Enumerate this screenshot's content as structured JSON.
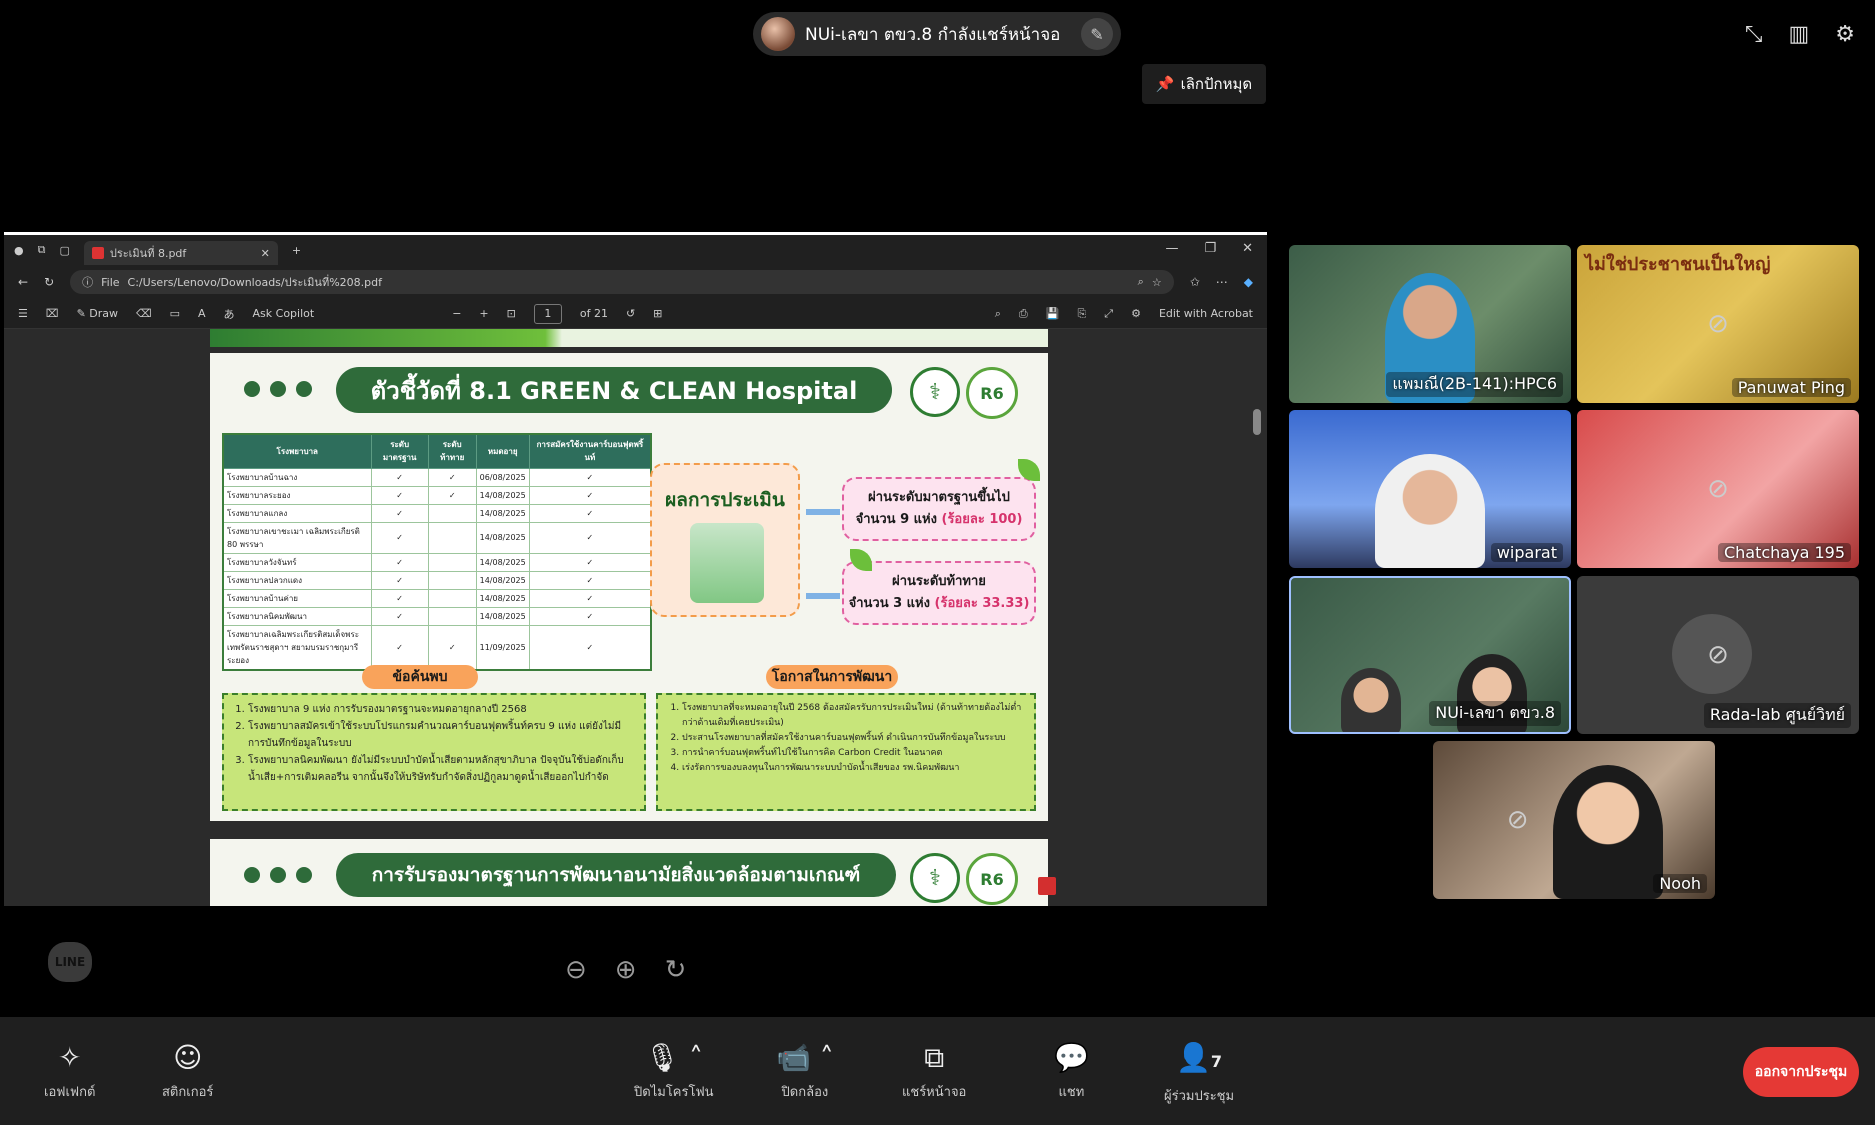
{
  "presenter": {
    "label": "NUi-เลขา ตขว.8 กำลังแชร์หน้าจอ"
  },
  "unpin": {
    "label": "เลิกปักหมุด"
  },
  "browser": {
    "tab_title": "ประเมินที่ 8.pdf",
    "address_prefix": "File",
    "address": "C:/Users/Lenovo/Downloads/ประเมินที่%208.pdf",
    "pdf_draw": "Draw",
    "ask_copilot": "Ask Copilot",
    "page_num": "1",
    "page_total": "of 21",
    "edit_acrobat": "Edit with Acrobat"
  },
  "slide": {
    "title": "ตัวชี้วัดที่ 8.1 GREEN & CLEAN Hospital",
    "logo2_text": "R6",
    "table_headers": [
      "โรงพยาบาล",
      "ระดับมาตรฐาน",
      "ระดับท้าทาย",
      "หมดอายุ",
      "การสมัครใช้งานคาร์บอนฟุตพริ้นท์"
    ],
    "rows": [
      [
        "โรงพยาบาลบ้านฉาง",
        "✓",
        "✓",
        "06/08/2025",
        "✓"
      ],
      [
        "โรงพยาบาลระยอง",
        "✓",
        "✓",
        "14/08/2025",
        "✓"
      ],
      [
        "โรงพยาบาลแกลง",
        "✓",
        "",
        "14/08/2025",
        "✓"
      ],
      [
        "โรงพยาบาลเขาชะเมา เฉลิมพระเกียรติ 80 พรรษา",
        "✓",
        "",
        "14/08/2025",
        "✓"
      ],
      [
        "โรงพยาบาลวังจันทร์",
        "✓",
        "",
        "14/08/2025",
        "✓"
      ],
      [
        "โรงพยาบาลปลวกแดง",
        "✓",
        "",
        "14/08/2025",
        "✓"
      ],
      [
        "โรงพยาบาลบ้านค่าย",
        "✓",
        "",
        "14/08/2025",
        "✓"
      ],
      [
        "โรงพยาบาลนิคมพัฒนา",
        "✓",
        "",
        "14/08/2025",
        "✓"
      ],
      [
        "โรงพยาบาลเฉลิมพระเกียรติสมเด็จพระเทพรัตนราชสุดาฯ สยามบรมราชกุมารี ระยอง",
        "✓",
        "✓",
        "11/09/2025",
        "✓"
      ]
    ],
    "eval_label": "ผลการประเมิน",
    "result1_line1": "ผ่านระดับมาตรฐานขึ้นไป",
    "result1_line2": "จำนวน 9 แห่ง",
    "result1_pct": "(ร้อยละ 100)",
    "result2_line1": "ผ่านระดับท้าทาย",
    "result2_line2": "จำนวน 3 แห่ง",
    "result2_pct": "(ร้อยละ 33.33)",
    "findings_title": "ข้อค้นพบ",
    "findings": [
      "โรงพยาบาล 9 แห่ง การรับรองมาตรฐานจะหมดอายุกลางปี 2568",
      "โรงพยาบาลสมัครเข้าใช้ระบบโปรแกรมคำนวณคาร์บอนฟุตพริ้นท์ครบ 9 แห่ง แต่ยังไม่มีการบันทึกข้อมูลในระบบ",
      "โรงพยาบาลนิคมพัฒนา ยังไม่มีระบบบำบัดน้ำเสียตามหลักสุขาภิบาล ปัจจุบันใช้บ่อดักเก็บน้ำเสีย+การเติมคลอรีน จากนั้นจึงให้บริษัทรับกำจัดสิ่งปฏิกูลมาดูดน้ำเสียออกไปกำจัด"
    ],
    "opps_title": "โอกาสในการพัฒนา",
    "opps": [
      "โรงพยาบาลที่จะหมดอายุในปี 2568 ต้องสมัครรับการประเมินใหม่ (ด้านท้าทายต้องไม่ต่ำกว่าด้านเดิมที่เคยประเมิน)",
      "ประสานโรงพยาบาลที่สมัครใช้งานคาร์บอนฟุตพริ้นท์ ดำเนินการบันทึกข้อมูลในระบบ",
      "การนำคาร์บอนฟุตพริ้นท์ไปใช้ในการคิด Carbon Credit ในอนาคต",
      "เร่งรัดการของบลงทุนในการพัฒนาระบบบำบัดน้ำเสียของ รพ.นิคมพัฒนา"
    ],
    "slide2_title": "การรับรองมาตรฐานการพัฒนาอนามัยสิ่งแวดล้อมตามเกณฑ์"
  },
  "line_logo": "LINE",
  "participants": [
    {
      "name": "แพมณี(2B-141):HPC6"
    },
    {
      "name": "Panuwat Ping",
      "sign": "ไม่ใช่ประชาชนเป็นใหญ่"
    },
    {
      "name": "wiparat"
    },
    {
      "name": "Chatchaya 195"
    },
    {
      "name": "NUi-เลขา ตขว.8"
    },
    {
      "name": "Rada-lab ศูนย์วิทย์"
    },
    {
      "name": "Nooh"
    }
  ],
  "toolbar": {
    "effects": "เอฟเฟกต์",
    "stickers": "สติกเกอร์",
    "mute": "ปิดไมโครโฟน",
    "camera": "ปิดกล้อง",
    "share": "แชร์หน้าจอ",
    "chat": "แชท",
    "participants": "ผู้ร่วมประชุม",
    "participant_count": "7",
    "leave": "ออกจากประชุม"
  }
}
